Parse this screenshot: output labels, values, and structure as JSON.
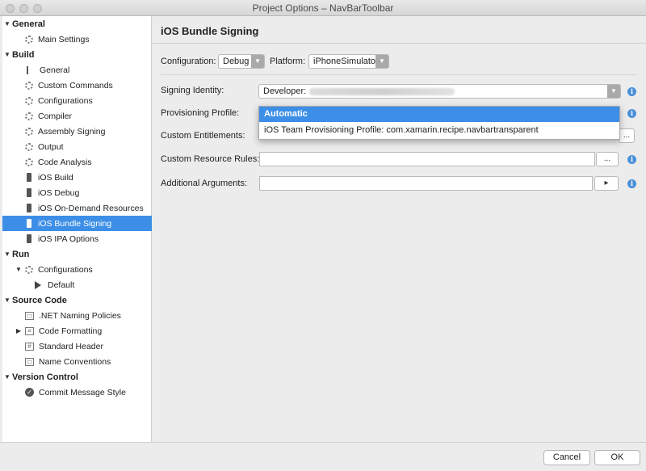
{
  "window": {
    "title": "Project Options – NavBarToolbar"
  },
  "sidebar": {
    "items": [
      {
        "label": "General",
        "kind": "header",
        "expanded": true
      },
      {
        "label": "Main Settings",
        "icon": "gear-icon"
      },
      {
        "label": "Build",
        "kind": "header",
        "expanded": true
      },
      {
        "label": "General",
        "icon": "general-icon"
      },
      {
        "label": "Custom Commands",
        "icon": "gear-icon"
      },
      {
        "label": "Configurations",
        "icon": "gear-icon"
      },
      {
        "label": "Compiler",
        "icon": "gear-icon"
      },
      {
        "label": "Assembly Signing",
        "icon": "gear-icon"
      },
      {
        "label": "Output",
        "icon": "gear-icon"
      },
      {
        "label": "Code Analysis",
        "icon": "gear-icon"
      },
      {
        "label": "iOS Build",
        "icon": "phone-icon"
      },
      {
        "label": "iOS Debug",
        "icon": "phone-icon"
      },
      {
        "label": "iOS On-Demand Resources",
        "icon": "phone-icon"
      },
      {
        "label": "iOS Bundle Signing",
        "icon": "phone-icon",
        "selected": true
      },
      {
        "label": "iOS IPA Options",
        "icon": "phone-icon"
      },
      {
        "label": "Run",
        "kind": "header",
        "expanded": true
      },
      {
        "label": "Configurations",
        "icon": "gear-icon",
        "expanded": true
      },
      {
        "label": "Default",
        "icon": "play-icon"
      },
      {
        "label": "Source Code",
        "kind": "header",
        "expanded": true
      },
      {
        "label": ".NET Naming Policies",
        "icon": "naming-icon"
      },
      {
        "label": "Code Formatting",
        "icon": "formatting-icon",
        "collapsed": true
      },
      {
        "label": "Standard Header",
        "icon": "hash-icon"
      },
      {
        "label": "Name Conventions",
        "icon": "naming-icon"
      },
      {
        "label": "Version Control",
        "kind": "header",
        "expanded": true
      },
      {
        "label": "Commit Message Style",
        "icon": "check-icon"
      }
    ]
  },
  "main": {
    "title": "iOS Bundle Signing",
    "configuration_label": "Configuration:",
    "configuration_value": "Debug",
    "platform_label": "Platform:",
    "platform_value": "iPhoneSimulator",
    "signing_identity_label": "Signing Identity:",
    "signing_identity_value": "Developer:",
    "provisioning_profile_label": "Provisioning Profile:",
    "custom_entitlements_label": "Custom Entitlements:",
    "custom_resource_rules_label": "Custom Resource Rules:",
    "additional_arguments_label": "Additional Arguments:",
    "browse_label": "...",
    "run_label": "▸",
    "info_glyph": "i"
  },
  "dropdown": {
    "items": [
      {
        "label": "Automatic",
        "active": true
      },
      {
        "label": "iOS Team Provisioning Profile: com.xamarin.recipe.navbartransparent"
      }
    ]
  },
  "footer": {
    "cancel_label": "Cancel",
    "ok_label": "OK"
  },
  "colors": {
    "selection": "#3d8ee6",
    "info": "#4a90d9"
  }
}
